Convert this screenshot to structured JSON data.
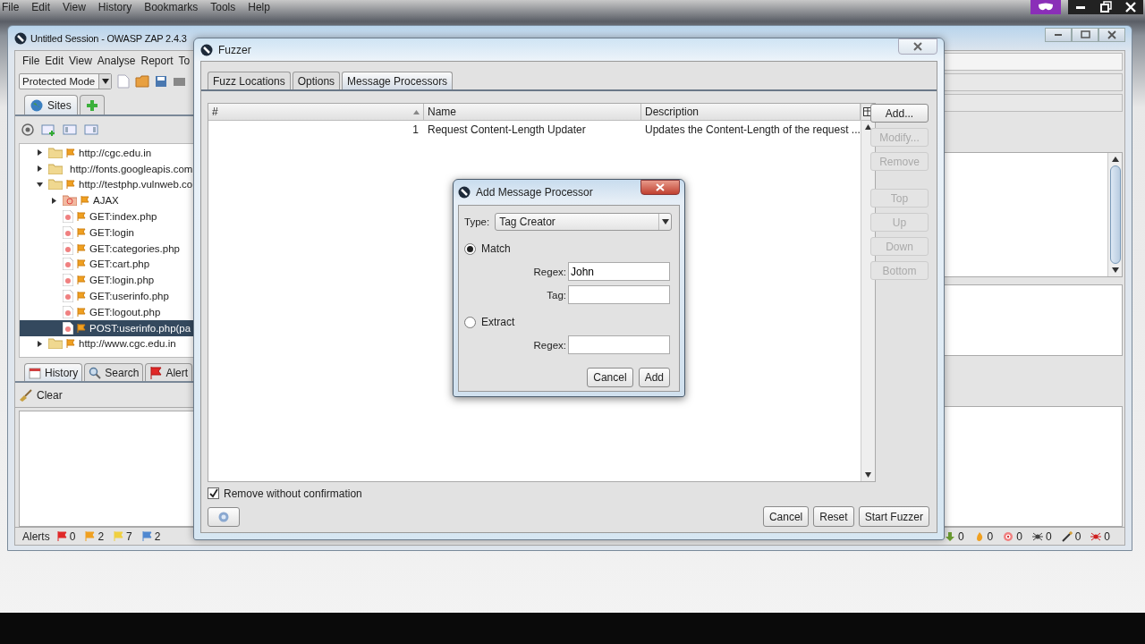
{
  "browser_menu": [
    "File",
    "Edit",
    "View",
    "History",
    "Bookmarks",
    "Tools",
    "Help"
  ],
  "zap": {
    "title": "Untitled Session - OWASP ZAP 2.4.3",
    "menu": [
      "File",
      "Edit",
      "View",
      "Analyse",
      "Report",
      "To"
    ],
    "mode": "Protected Mode",
    "sites_tab": {
      "label": "Sites",
      "selected": true
    },
    "tree": [
      {
        "label": "http://cgc.edu.in",
        "kind": "folder",
        "flagged": true,
        "expanded": false,
        "selected": false
      },
      {
        "label": "http://fonts.googleapis.com",
        "kind": "folder",
        "flagged": false,
        "expanded": false,
        "selected": false
      },
      {
        "label": "http://testphp.vulnweb.co",
        "kind": "folder",
        "flagged": true,
        "expanded": true,
        "selected": false,
        "children": [
          {
            "label": "AJAX",
            "kind": "target-folder",
            "flagged": true,
            "expanded": false,
            "selected": false
          },
          {
            "label": "GET:index.php",
            "kind": "page",
            "flagged": true,
            "selected": false
          },
          {
            "label": "GET:login",
            "kind": "page",
            "flagged": true,
            "selected": false
          },
          {
            "label": "GET:categories.php",
            "kind": "page",
            "flagged": true,
            "selected": false
          },
          {
            "label": "GET:cart.php",
            "kind": "page",
            "flagged": true,
            "selected": false
          },
          {
            "label": "GET:login.php",
            "kind": "page",
            "flagged": true,
            "selected": false
          },
          {
            "label": "GET:userinfo.php",
            "kind": "page",
            "flagged": true,
            "selected": false
          },
          {
            "label": "GET:logout.php",
            "kind": "page",
            "flagged": true,
            "selected": false
          },
          {
            "label": "POST:userinfo.php(pa",
            "kind": "page",
            "flagged": true,
            "selected": true
          }
        ]
      },
      {
        "label": "http://www.cgc.edu.in",
        "kind": "folder",
        "flagged": true,
        "expanded": false,
        "selected": false
      }
    ],
    "bottom_tabs": [
      {
        "label": "History",
        "kind": "calendar",
        "selected": true
      },
      {
        "label": "Search",
        "kind": "search",
        "selected": false
      },
      {
        "label": "Alert",
        "kind": "flag",
        "selected": false
      }
    ],
    "clear": "Clear",
    "alerts": {
      "label": "Alerts",
      "counts": [
        {
          "color": "#e02828",
          "count": "0"
        },
        {
          "color": "#f0a020",
          "count": "2"
        },
        {
          "color": "#f0d040",
          "count": "7"
        },
        {
          "color": "#5088d0",
          "count": "2"
        }
      ]
    },
    "status_counts": [
      {
        "kind": "arrow",
        "count": "0"
      },
      {
        "kind": "flame",
        "count": "0"
      },
      {
        "kind": "target",
        "count": "0"
      },
      {
        "kind": "spider",
        "count": "0"
      },
      {
        "kind": "wand",
        "count": "0"
      },
      {
        "kind": "bug",
        "count": "0"
      }
    ]
  },
  "fuzzer": {
    "title": "Fuzzer",
    "tabs": [
      {
        "label": "Fuzz Locations",
        "selected": false
      },
      {
        "label": "Options",
        "selected": false
      },
      {
        "label": "Message Processors",
        "selected": true
      }
    ],
    "table": {
      "columns": [
        "#",
        "Name",
        "Description"
      ],
      "rows": [
        [
          "1",
          "Request Content-Length Updater",
          "Updates the Content-Length of the request ..."
        ]
      ]
    },
    "side_buttons": [
      {
        "label": "Add...",
        "disabled": false
      },
      {
        "label": "Modify...",
        "disabled": true
      },
      {
        "label": "Remove",
        "disabled": true
      },
      {
        "label": "Top",
        "disabled": true
      },
      {
        "label": "Up",
        "disabled": true
      },
      {
        "label": "Down",
        "disabled": true
      },
      {
        "label": "Bottom",
        "disabled": true
      }
    ],
    "remove_without_confirmation": {
      "label": "Remove without confirmation",
      "checked": true
    },
    "buttons": [
      "Cancel",
      "Reset",
      "Start Fuzzer"
    ]
  },
  "dialog": {
    "title": "Add Message Processor",
    "type_label": "Type:",
    "type_value": "Tag Creator",
    "options": [
      {
        "label": "Match",
        "selected": true,
        "fields": [
          {
            "label": "Regex:",
            "value": "John"
          },
          {
            "label": "Tag:"
          }
        ]
      },
      {
        "label": "Extract",
        "selected": false,
        "fields": [
          {
            "label": "Regex:"
          }
        ]
      }
    ],
    "buttons": [
      "Cancel",
      "Add"
    ]
  }
}
